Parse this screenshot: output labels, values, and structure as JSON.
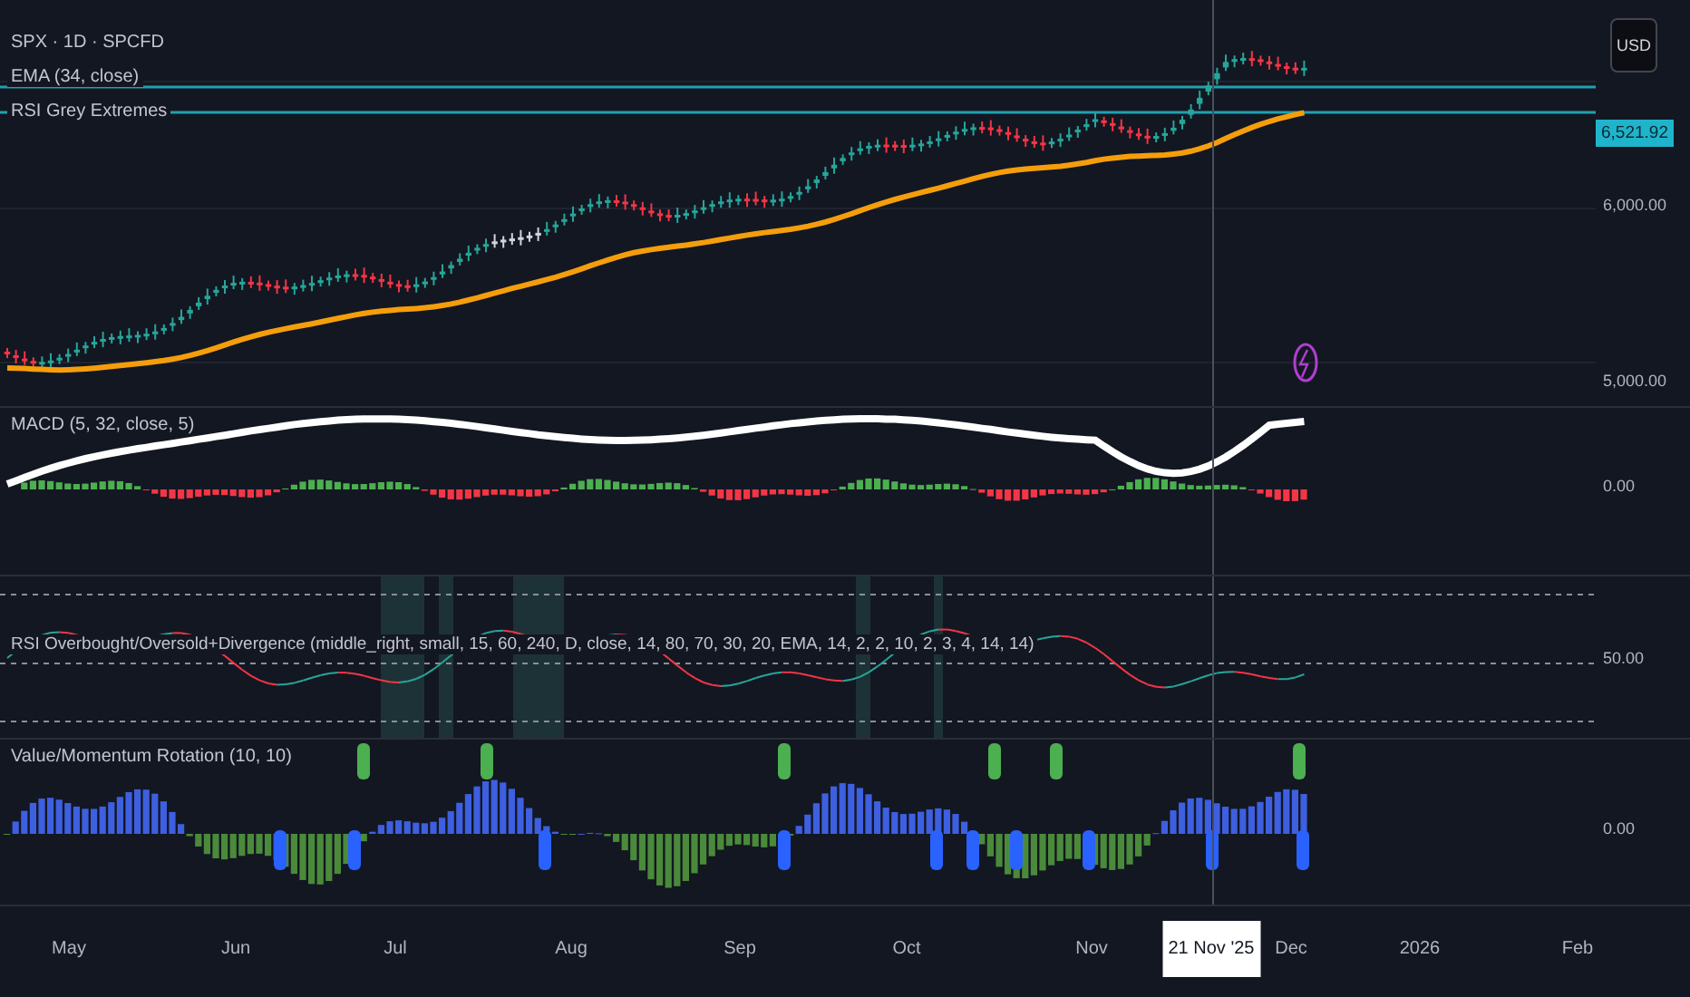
{
  "main_pane": {
    "legend": [
      "SPX · 1D · SPCFD",
      "EMA (34, close)",
      "RSI Grey Extremes"
    ],
    "currency": "USD",
    "last_price": "6,521.92",
    "price_labels": [
      "6,000.00",
      "5,000.00"
    ]
  },
  "macd_pane": {
    "legend": "MACD (5, 32, close, 5)",
    "axis_label": "0.00"
  },
  "rsi_pane": {
    "legend": "RSI Overbought/Oversold+Divergence (middle_right, small, 15, 60, 240, D, close, 14, 80, 70, 30, 20, EMA, 14, 2, 2, 10, 2, 3, 4, 14, 14)",
    "axis_label": "50.00"
  },
  "value_pane": {
    "legend": "Value/Momentum Rotation (10, 10)",
    "axis_label": "0.00"
  },
  "time_axis": [
    {
      "text": "May",
      "selected": false
    },
    {
      "text": "Jun",
      "selected": false
    },
    {
      "text": "Jul",
      "selected": false
    },
    {
      "text": "Aug",
      "selected": false
    },
    {
      "text": "Sep",
      "selected": false
    },
    {
      "text": "Oct",
      "selected": false
    },
    {
      "text": "Nov",
      "selected": false
    },
    {
      "text": "21 Nov '25",
      "selected": true
    },
    {
      "text": "Dec",
      "selected": false
    },
    {
      "text": "2026",
      "selected": false
    },
    {
      "text": "Feb",
      "selected": false
    }
  ]
}
